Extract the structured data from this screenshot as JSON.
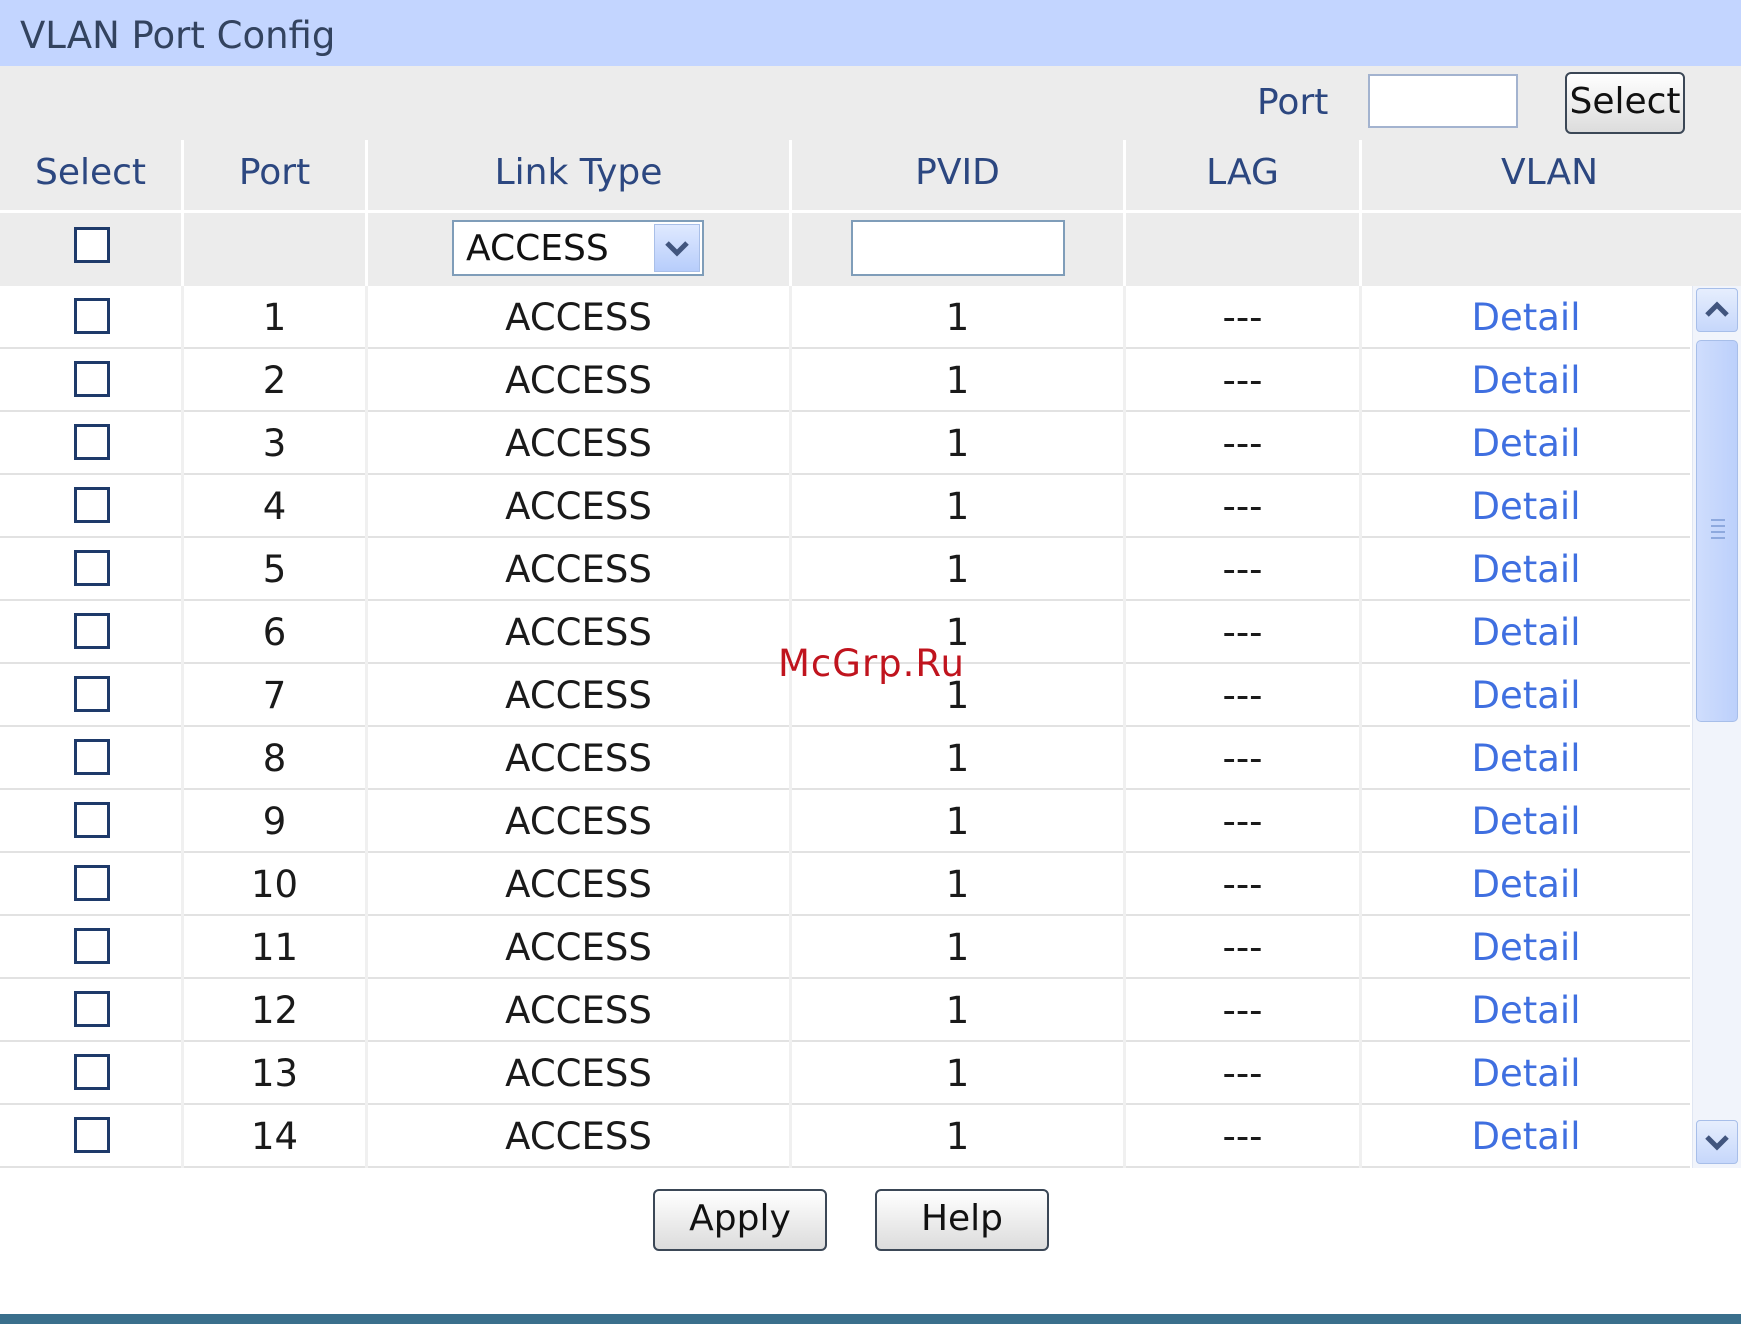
{
  "title": "VLAN Port Config",
  "port_filter": {
    "label": "Port",
    "value": "",
    "select_button": "Select"
  },
  "columns": [
    "Select",
    "Port",
    "Link Type",
    "PVID",
    "LAG",
    "VLAN"
  ],
  "bulk_edit": {
    "link_type": "ACCESS",
    "pvid": ""
  },
  "rows": [
    {
      "port": "1",
      "link_type": "ACCESS",
      "pvid": "1",
      "lag": "---",
      "vlan": "Detail"
    },
    {
      "port": "2",
      "link_type": "ACCESS",
      "pvid": "1",
      "lag": "---",
      "vlan": "Detail"
    },
    {
      "port": "3",
      "link_type": "ACCESS",
      "pvid": "1",
      "lag": "---",
      "vlan": "Detail"
    },
    {
      "port": "4",
      "link_type": "ACCESS",
      "pvid": "1",
      "lag": "---",
      "vlan": "Detail"
    },
    {
      "port": "5",
      "link_type": "ACCESS",
      "pvid": "1",
      "lag": "---",
      "vlan": "Detail"
    },
    {
      "port": "6",
      "link_type": "ACCESS",
      "pvid": "1",
      "lag": "---",
      "vlan": "Detail"
    },
    {
      "port": "7",
      "link_type": "ACCESS",
      "pvid": "1",
      "lag": "---",
      "vlan": "Detail"
    },
    {
      "port": "8",
      "link_type": "ACCESS",
      "pvid": "1",
      "lag": "---",
      "vlan": "Detail"
    },
    {
      "port": "9",
      "link_type": "ACCESS",
      "pvid": "1",
      "lag": "---",
      "vlan": "Detail"
    },
    {
      "port": "10",
      "link_type": "ACCESS",
      "pvid": "1",
      "lag": "---",
      "vlan": "Detail"
    },
    {
      "port": "11",
      "link_type": "ACCESS",
      "pvid": "1",
      "lag": "---",
      "vlan": "Detail"
    },
    {
      "port": "12",
      "link_type": "ACCESS",
      "pvid": "1",
      "lag": "---",
      "vlan": "Detail"
    },
    {
      "port": "13",
      "link_type": "ACCESS",
      "pvid": "1",
      "lag": "---",
      "vlan": "Detail"
    },
    {
      "port": "14",
      "link_type": "ACCESS",
      "pvid": "1",
      "lag": "---",
      "vlan": "Detail"
    }
  ],
  "buttons": {
    "apply": "Apply",
    "help": "Help"
  },
  "watermark": "McGrp.Ru",
  "colors": {
    "title_bg": "#c3d5ff",
    "header_bg": "#ececec",
    "link": "#3f6fe0",
    "bottom_bar": "#3a6f8c"
  }
}
